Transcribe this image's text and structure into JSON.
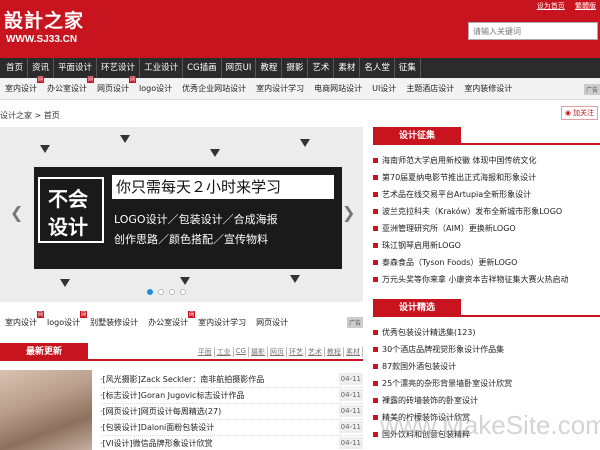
{
  "header": {
    "logo_main": "設計之家",
    "logo_url": "WWW.SJ33.CN",
    "top_links": [
      "设为首页",
      "繁體版"
    ],
    "search_placeholder": "请输入关键词"
  },
  "nav": [
    "首页",
    "资讯",
    "平面设计",
    "环艺设计",
    "工业设计",
    "CG插画",
    "网页UI",
    "教程",
    "摄影",
    "艺术",
    "素材",
    "名人堂",
    "征集"
  ],
  "subnav": {
    "items": [
      {
        "label": "室内设计",
        "badge": "网"
      },
      {
        "label": "办公室设计",
        "badge": "网"
      },
      {
        "label": "网页设计",
        "badge": "网"
      },
      {
        "label": "logo设计",
        "badge": ""
      },
      {
        "label": "优秀企业网站设计",
        "badge": ""
      },
      {
        "label": "室内设计学习",
        "badge": ""
      },
      {
        "label": "电商网站设计",
        "badge": ""
      },
      {
        "label": "UI设计",
        "badge": ""
      },
      {
        "label": "主题酒店设计",
        "badge": ""
      },
      {
        "label": "室内装修设计",
        "badge": ""
      }
    ],
    "ad": "广告"
  },
  "breadcrumb": "设计之家 > 首页",
  "add_fav": "加关注",
  "banner": {
    "big1": "不会",
    "big2": "设计",
    "headline": "你只需每天２小时来学习",
    "line1": "LOGO设计／包装设计／合成海报",
    "line2": "创作思路／颜色搭配／宣传物料",
    "left_arrow": "❮",
    "right_arrow": "❯"
  },
  "cattabs": {
    "items": [
      {
        "label": "室内设计",
        "badge": "网"
      },
      {
        "label": "logo设计",
        "badge": "网"
      },
      {
        "label": "别墅装修设计",
        "badge": ""
      },
      {
        "label": "办公室设计",
        "badge": "网"
      },
      {
        "label": "室内设计学习",
        "badge": ""
      },
      {
        "label": "网页设计",
        "badge": ""
      }
    ],
    "ad": "广告"
  },
  "latest": {
    "title": "最新更新",
    "cats": [
      "平面",
      "工业",
      "CG",
      "摄影",
      "网页",
      "环艺",
      "艺术",
      "教程",
      "素材"
    ],
    "rows": [
      {
        "text": "·[风光摄影]Zack Seckler：南非航拍摄影作品",
        "date": "04-11"
      },
      {
        "text": "·[标志设计]Goran Jugovic标志设计作品",
        "date": "04-11"
      },
      {
        "text": "·[网页设计]网页设计每周精选(27)",
        "date": "04-11"
      },
      {
        "text": "·[包装设计]Daloni面粉包装设计",
        "date": "04-11"
      },
      {
        "text": "·[VI设计]微信品牌形象设计欣赏",
        "date": "04-11"
      }
    ]
  },
  "panel1": {
    "title": "设计征集",
    "rows": [
      "海南师范大学启用新校徽 体现中国传统文化",
      "第70届夏纳电影节推出正式海报和形象设计",
      "艺术品在线交易平台Artupia全新形象设计",
      "波兰克拉科夫（Kraków）发布全新城市形象LOGO",
      "亚洲管理研究所（AIM）更换新LOGO",
      "珠江钢琴启用新LOGO",
      "泰森食品（Tyson Foods）更新LOGO",
      "万元头奖等你来拿 小康资本吉祥物征集大赛火热启动"
    ]
  },
  "panel2": {
    "title": "设计精选",
    "rows": [
      "优秀包装设计精选集(123)",
      "30个酒店品牌视觉形象设计作品集",
      "87款国外酒包装设计",
      "25个漂亮的杂形背景墙卧室设计欣赏",
      "裸露的砖墙装饰的卧室设计",
      "精美的柠檬装饰设计欣赏",
      "国外饮料和创意包装精粹"
    ]
  },
  "watermark": "www.MakeSite.com"
}
